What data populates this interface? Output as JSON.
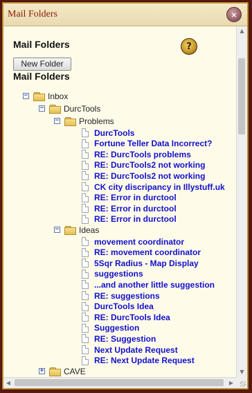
{
  "window": {
    "title": "Mail Folders",
    "close_glyph": "×"
  },
  "header": {
    "heading": "Mail Folders",
    "new_folder_label": "New Folder",
    "help_glyph": "?",
    "subheading": "Mail Folders"
  },
  "tree": {
    "inbox": {
      "toggle": "−",
      "label": "Inbox"
    },
    "durctools": {
      "toggle": "−",
      "label": "DurcTools"
    },
    "problems": {
      "toggle": "−",
      "label": "Problems",
      "messages": [
        "DurcTools",
        "Fortune Teller Data Incorrect?",
        "RE: DurcTools problems",
        "RE: DurcTools2 not working",
        "RE: DurcTools2 not working",
        "CK city discripancy in Illystuff.uk",
        "RE: Error in durctool",
        "RE: Error in durctool",
        "RE: Error in durctool"
      ]
    },
    "ideas": {
      "toggle": "−",
      "label": "Ideas",
      "messages": [
        "movement coordinator",
        "RE: movement coordinator",
        "5Sqr Radius - Map Display",
        "suggestions",
        "...and another little suggestion",
        "RE: suggestions",
        "DurcTools Idea",
        "RE: DurcTools Idea",
        "Suggestion",
        "RE: Suggestion",
        "Next Update Request",
        "RE: Next Update Request"
      ]
    },
    "cave": {
      "toggle": "+",
      "label": "CAVE"
    }
  },
  "icons": {
    "folder": "folder-icon",
    "message": "document-icon",
    "help": "help-icon",
    "close": "close-icon"
  },
  "colors": {
    "title_text": "#8a1a08",
    "link": "#1111cc",
    "panel_bg": "#fffbe9",
    "frame_border": "#c0893a"
  }
}
